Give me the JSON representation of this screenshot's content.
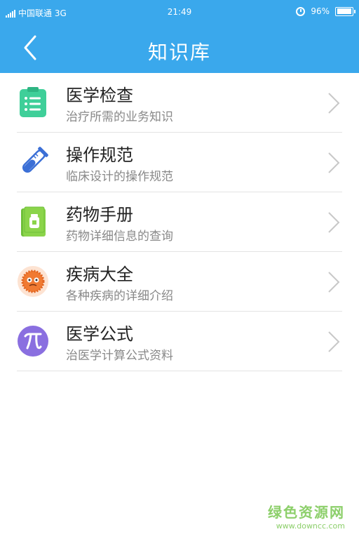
{
  "status_bar": {
    "carrier": "中国联通 3G",
    "time": "21:49",
    "battery_percent": "96%",
    "battery_level": 0.96
  },
  "nav": {
    "title": "知识库",
    "back_icon": "chevron-left-icon"
  },
  "items": [
    {
      "title": "医学检查",
      "subtitle": "治疗所需的业务知识",
      "icon": "clipboard-icon",
      "color": "#3fcf99"
    },
    {
      "title": "操作规范",
      "subtitle": "临床设计的操作规范",
      "icon": "test-tube-icon",
      "color": "#3b6fd6"
    },
    {
      "title": "药物手册",
      "subtitle": "药物详细信息的查询",
      "icon": "medicine-book-icon",
      "color": "#8bd44a"
    },
    {
      "title": "疾病大全",
      "subtitle": "各种疾病的详细介绍",
      "icon": "virus-icon",
      "color": "#f07a32"
    },
    {
      "title": "医学公式",
      "subtitle": "治医学计算公式资料",
      "icon": "pi-icon",
      "color": "#8a6fe0"
    }
  ],
  "watermark": {
    "name": "绿色资源网",
    "url": "www.downcc.com"
  },
  "colors": {
    "primary": "#3aa8ec",
    "divider": "#e3e3e3",
    "title_text": "#222222",
    "subtitle_text": "#888888"
  }
}
